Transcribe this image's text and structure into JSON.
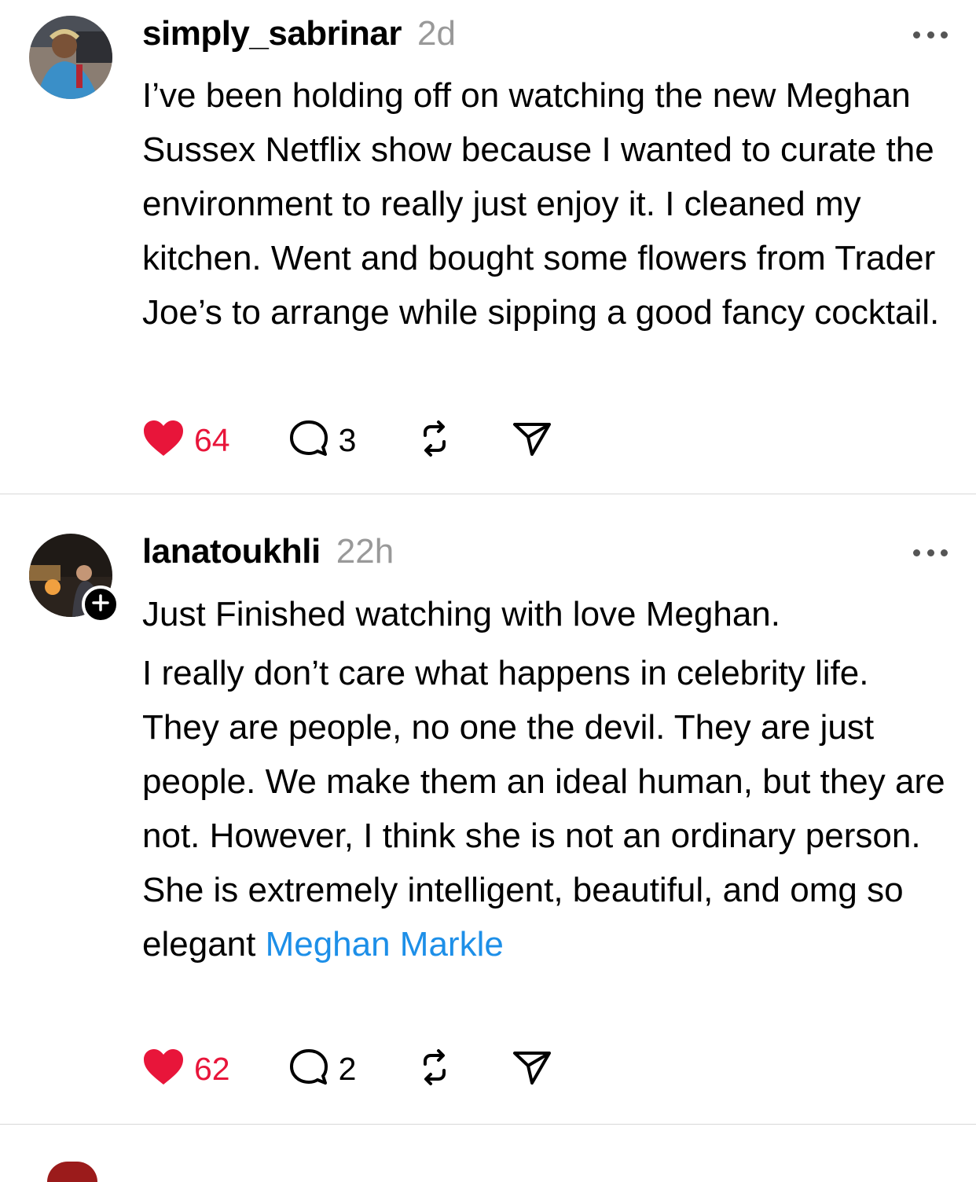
{
  "posts": [
    {
      "username": "simply_sabrinar",
      "timestamp": "2d",
      "text": "I’ve been holding off on watching the new Meghan Sussex Netflix show because I wanted to curate the environment to really just enjoy it. I cleaned my kitchen. Went and bought some flowers from Trader Joe’s to arrange while sipping a good fancy cocktail.",
      "likes": "64",
      "replies": "3"
    },
    {
      "username": "lanatoukhli",
      "timestamp": "22h",
      "text_first": "Just Finished watching with love Meghan.",
      "text_rest": "I really don’t care what happens in celebrity life. They are people, no one the devil. They are just people. We make them an ideal human, but they are not. However, I think she is not an ordinary person. She is extremely intelligent, beautiful, and omg so elegant ",
      "mention": "Meghan Markle",
      "likes": "62",
      "replies": "2"
    }
  ],
  "icons": {
    "like": "heart-icon",
    "reply": "comment-icon",
    "repost": "repost-icon",
    "share": "send-icon",
    "more": "more-icon",
    "follow": "plus-icon"
  },
  "colors": {
    "like": "#e8153a",
    "link": "#1d8fe8",
    "timestamp": "#999999",
    "divider": "#d8d8d8"
  }
}
